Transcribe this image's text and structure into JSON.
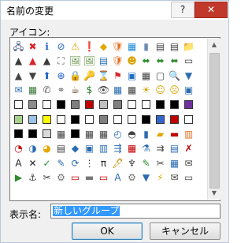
{
  "dialog": {
    "title": "名前の変更",
    "help_label": "?",
    "close_label": "✕"
  },
  "icons": {
    "label": "アイコン:",
    "scroll_up": "▲",
    "scroll_down": "▼",
    "rows": [
      [
        {
          "g": "🖧",
          "c": "#2e3c6e"
        },
        {
          "g": "✖",
          "c": "#d9262b"
        },
        {
          "g": "ℹ",
          "c": "#1f63c6"
        },
        {
          "g": "⊘",
          "c": "#1f63c6"
        },
        {
          "g": "⚠",
          "c": "#e0a800"
        },
        {
          "g": "❗",
          "c": "#333333"
        },
        {
          "g": "◆",
          "c": "#e0a800"
        },
        {
          "g": "🛡",
          "c": "#e06f1f"
        },
        {
          "g": "▦",
          "c": "#1e8bd6"
        },
        {
          "g": "▮",
          "c": "#6a8bb1"
        },
        {
          "g": "▤",
          "c": "#444444"
        },
        {
          "g": "▤",
          "c": "#444444"
        },
        {
          "g": "📁",
          "c": "#e0b84d"
        }
      ],
      [
        {
          "g": "▲",
          "c": "#3a3a3a"
        },
        {
          "g": "▲",
          "c": "#d9262b"
        },
        {
          "g": "▲",
          "c": "#3a3a3a"
        },
        {
          "g": "⛶",
          "c": "#555555"
        },
        {
          "g": "🖼",
          "c": "#5a8c3a"
        },
        {
          "g": "🖼",
          "c": "#5a8c3a"
        },
        {
          "g": "▤",
          "c": "#2b6cb0"
        },
        {
          "g": "🛡",
          "c": "#e06f1f"
        },
        {
          "g": "☻",
          "c": "#d8a200"
        },
        {
          "g": "⬌",
          "c": "#2e8b2e"
        },
        {
          "g": "⬌",
          "c": "#2e8b2e"
        },
        {
          "g": "⬌",
          "c": "#2e8b2e"
        },
        {
          "g": "▭",
          "c": "#444444"
        }
      ],
      [
        {
          "g": "▲",
          "c": "#444444"
        },
        {
          "g": "▼",
          "c": "#444444"
        },
        {
          "g": "⬆",
          "c": "#1f63c6"
        },
        {
          "g": "⊕",
          "c": "#1f63c6"
        },
        {
          "g": "🔒",
          "c": "#c08d00"
        },
        {
          "g": "🔑",
          "c": "#c08d00"
        },
        {
          "g": "⌛",
          "c": "#b5651d"
        },
        {
          "g": "⚑",
          "c": "#d9262b"
        },
        {
          "g": "▣",
          "c": "#1e6fbf"
        },
        {
          "g": "▦",
          "c": "#444444"
        },
        {
          "g": "▢",
          "c": "#444444"
        },
        {
          "g": "🔍",
          "c": "#444444"
        },
        {
          "g": "▼",
          "c": "#2b6cb0"
        }
      ],
      [
        {
          "g": "✉",
          "c": "#2b6cb0"
        },
        {
          "g": "▦",
          "c": "#3a7a3a"
        },
        {
          "g": "✆",
          "c": "#555555"
        },
        {
          "g": "⚭",
          "c": "#777777"
        },
        {
          "g": "☕",
          "c": "#5b3a1a"
        },
        {
          "g": "$",
          "c": "#1f7a1f"
        },
        {
          "g": "👁",
          "c": "#444444"
        },
        {
          "g": "▦",
          "c": "#2b6cb0"
        },
        {
          "g": "▦",
          "c": "#444444"
        },
        {
          "g": "☀",
          "c": "#d8a200"
        },
        {
          "g": "☺",
          "c": "#d8a200"
        },
        {
          "g": "☹",
          "c": "#d8a200"
        },
        {
          "g": "▣",
          "c": "#2b6cb0"
        }
      ],
      [
        {
          "s": "#ffffff"
        },
        {
          "s": "#8c8c8c"
        },
        {
          "s": "#ffffff"
        },
        {
          "s": "#000000"
        },
        {
          "s": "#7f7f7f"
        },
        {
          "s": "#c00000"
        },
        {
          "s": "#c0c0c0"
        },
        {
          "s": "#7f7f7f"
        },
        {
          "s": "#ffffff"
        },
        {
          "s": "#ffffff"
        },
        {
          "s": "#000000"
        },
        {
          "s": "#000000"
        },
        {
          "s": "#7030a0"
        }
      ],
      [
        {
          "s": "#a9d18e"
        },
        {
          "s": "#9dc3e6"
        },
        {
          "s": "#ffff00"
        },
        {
          "s": "#ffffff"
        },
        {
          "s": "#000000"
        },
        {
          "s": "#ffffff"
        },
        {
          "s": "#7f7f7f"
        },
        {
          "s": "#ffffff"
        },
        {
          "s": "#ffffff"
        },
        {
          "s": "#000000"
        },
        {
          "s": "#3366cc"
        },
        {
          "s": "#c00000"
        },
        {
          "s": "#ffffff"
        }
      ],
      [
        {
          "s": "#000000"
        },
        {
          "s": "#000000"
        },
        {
          "s": "#d9d9d9"
        },
        {
          "g": "▦",
          "c": "#444444"
        },
        {
          "s": "#000000"
        },
        {
          "g": "▦",
          "c": "#444444"
        },
        {
          "g": "▦",
          "c": "#444444"
        },
        {
          "g": "◴",
          "c": "#2b6cb0"
        },
        {
          "g": "◓",
          "c": "#444444"
        },
        {
          "g": "▮",
          "c": "#2b6cb0"
        },
        {
          "g": "▰",
          "c": "#e0a800"
        },
        {
          "g": "▬",
          "c": "#c00000"
        },
        {
          "g": "▥",
          "c": "#e06f1f"
        }
      ],
      [
        {
          "g": "◔",
          "c": "#c00000"
        },
        {
          "g": "◑",
          "c": "#2b6cb0"
        },
        {
          "g": "◕",
          "c": "#e0a800"
        },
        {
          "g": "▤",
          "c": "#444444"
        },
        {
          "g": "◆",
          "c": "#2b6cb0"
        },
        {
          "g": "▣",
          "c": "#2b6cb0"
        },
        {
          "g": "▥",
          "c": "#2b6cb0"
        },
        {
          "g": "⇶",
          "c": "#2b6cb0"
        },
        {
          "g": "▦",
          "c": "#c00000"
        },
        {
          "g": "⚗",
          "c": "#2b6cb0"
        },
        {
          "g": "⇉",
          "c": "#444444"
        },
        {
          "g": "▤",
          "c": "#2b6cb0"
        },
        {
          "g": "✗",
          "c": "#c00000"
        }
      ],
      [
        {
          "g": "A",
          "c": "#222222"
        },
        {
          "g": "✕",
          "c": "#222222"
        },
        {
          "g": "✓",
          "c": "#2e8b2e"
        },
        {
          "g": "✎",
          "c": "#2b6cb0"
        },
        {
          "g": "⟳",
          "c": "#2b6cb0"
        },
        {
          "g": "⋮",
          "c": "#444444"
        },
        {
          "g": "π",
          "c": "#222222"
        },
        {
          "g": "🖋",
          "c": "#c08d00"
        },
        {
          "g": "♆",
          "c": "#444444"
        },
        {
          "g": "✎",
          "c": "#2e8b2e"
        },
        {
          "g": "✂",
          "c": "#444444"
        },
        {
          "g": "▦",
          "c": "#2b6cb0"
        },
        {
          "g": "✉",
          "c": "#444444"
        }
      ],
      [
        {
          "g": "▶",
          "c": "#2e8b2e"
        },
        {
          "g": "⚓",
          "c": "#444444"
        },
        {
          "g": "✂",
          "c": "#444444"
        },
        {
          "g": "⚙",
          "c": "#777777"
        },
        {
          "g": "▭",
          "c": "#c00000"
        },
        {
          "g": "▬",
          "c": "#777777"
        },
        {
          "g": "▭",
          "c": "#c00000"
        },
        {
          "g": "A",
          "c": "#2b6cb0"
        },
        {
          "g": "⚙",
          "c": "#777777"
        },
        {
          "g": "▼",
          "c": "#2b6cb0"
        },
        {
          "g": "⚡",
          "c": "#e0a800"
        },
        {
          "g": "✉",
          "c": "#444444"
        },
        {
          "g": "▭",
          "c": "#444444"
        }
      ],
      [
        {
          "g": "",
          "c": "#444444"
        },
        {
          "g": "",
          "c": "#444444"
        },
        {
          "g": "",
          "c": "#444444"
        },
        {
          "g": "",
          "c": "#444444"
        },
        {
          "g": "",
          "c": "#444444"
        },
        {
          "g": "",
          "c": "#444444"
        },
        {
          "g": "",
          "c": "#444444"
        },
        {
          "g": "",
          "c": "#444444"
        },
        {
          "g": "",
          "c": "#444444"
        },
        {
          "g": "",
          "c": "#444444"
        },
        {
          "g": "",
          "c": "#444444"
        },
        {
          "g": "",
          "c": "#444444"
        },
        {
          "g": "",
          "c": "#444444"
        }
      ]
    ]
  },
  "name_field": {
    "label": "表示名:",
    "value": "新しいグループ"
  },
  "buttons": {
    "ok": "OK",
    "cancel": "キャンセル"
  }
}
